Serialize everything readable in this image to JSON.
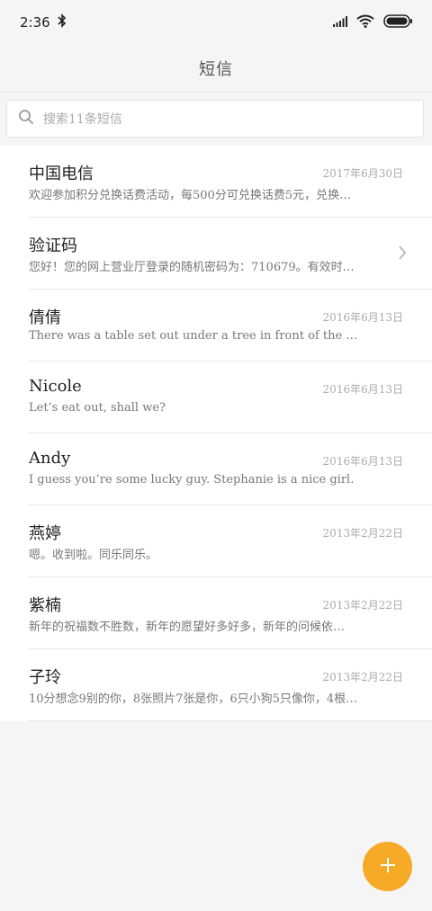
{
  "status": {
    "time": "2:36",
    "icons": [
      "bluetooth-icon",
      "signal-icon",
      "wifi-icon",
      "battery-icon"
    ]
  },
  "header": {
    "title": "短信"
  },
  "search": {
    "placeholder": "搜索11条短信"
  },
  "messages": [
    {
      "sender": "中国电信",
      "date": "2017年6月30日",
      "preview": "欢迎参加积分兑换话费活动，每500分可兑换话费5元，兑换…",
      "chevron": false
    },
    {
      "sender": "验证码",
      "date": "",
      "preview": "您好！您的网上营业厅登录的随机密码为：710679。有效时…",
      "chevron": true
    },
    {
      "sender": "倩倩",
      "date": "2016年6月13日",
      "preview": "There was a table set out under a tree in front of the …",
      "chevron": false
    },
    {
      "sender": "Nicole",
      "date": "2016年6月13日",
      "preview": "Let’s eat out, shall we?",
      "chevron": false
    },
    {
      "sender": "Andy",
      "date": "2016年6月13日",
      "preview": "I guess you’re some lucky guy. Stephanie is a nice girl.",
      "chevron": false
    },
    {
      "sender": "燕婷",
      "date": "2013年2月22日",
      "preview": "嗯。收到啦。同乐同乐。",
      "chevron": false
    },
    {
      "sender": "紫楠",
      "date": "2013年2月22日",
      "preview": "新年的祝福数不胜数，新年的愿望好多好多，新年的问候依…",
      "chevron": false
    },
    {
      "sender": "子玲",
      "date": "2013年2月22日",
      "preview": "10分想念9别的你，8张照片7张是你，6只小狗5只像你，4根…",
      "chevron": false
    }
  ],
  "fab": {
    "icon": "plus-icon"
  },
  "colors": {
    "accent": "#f7a928",
    "background": "#f5f5f5"
  }
}
